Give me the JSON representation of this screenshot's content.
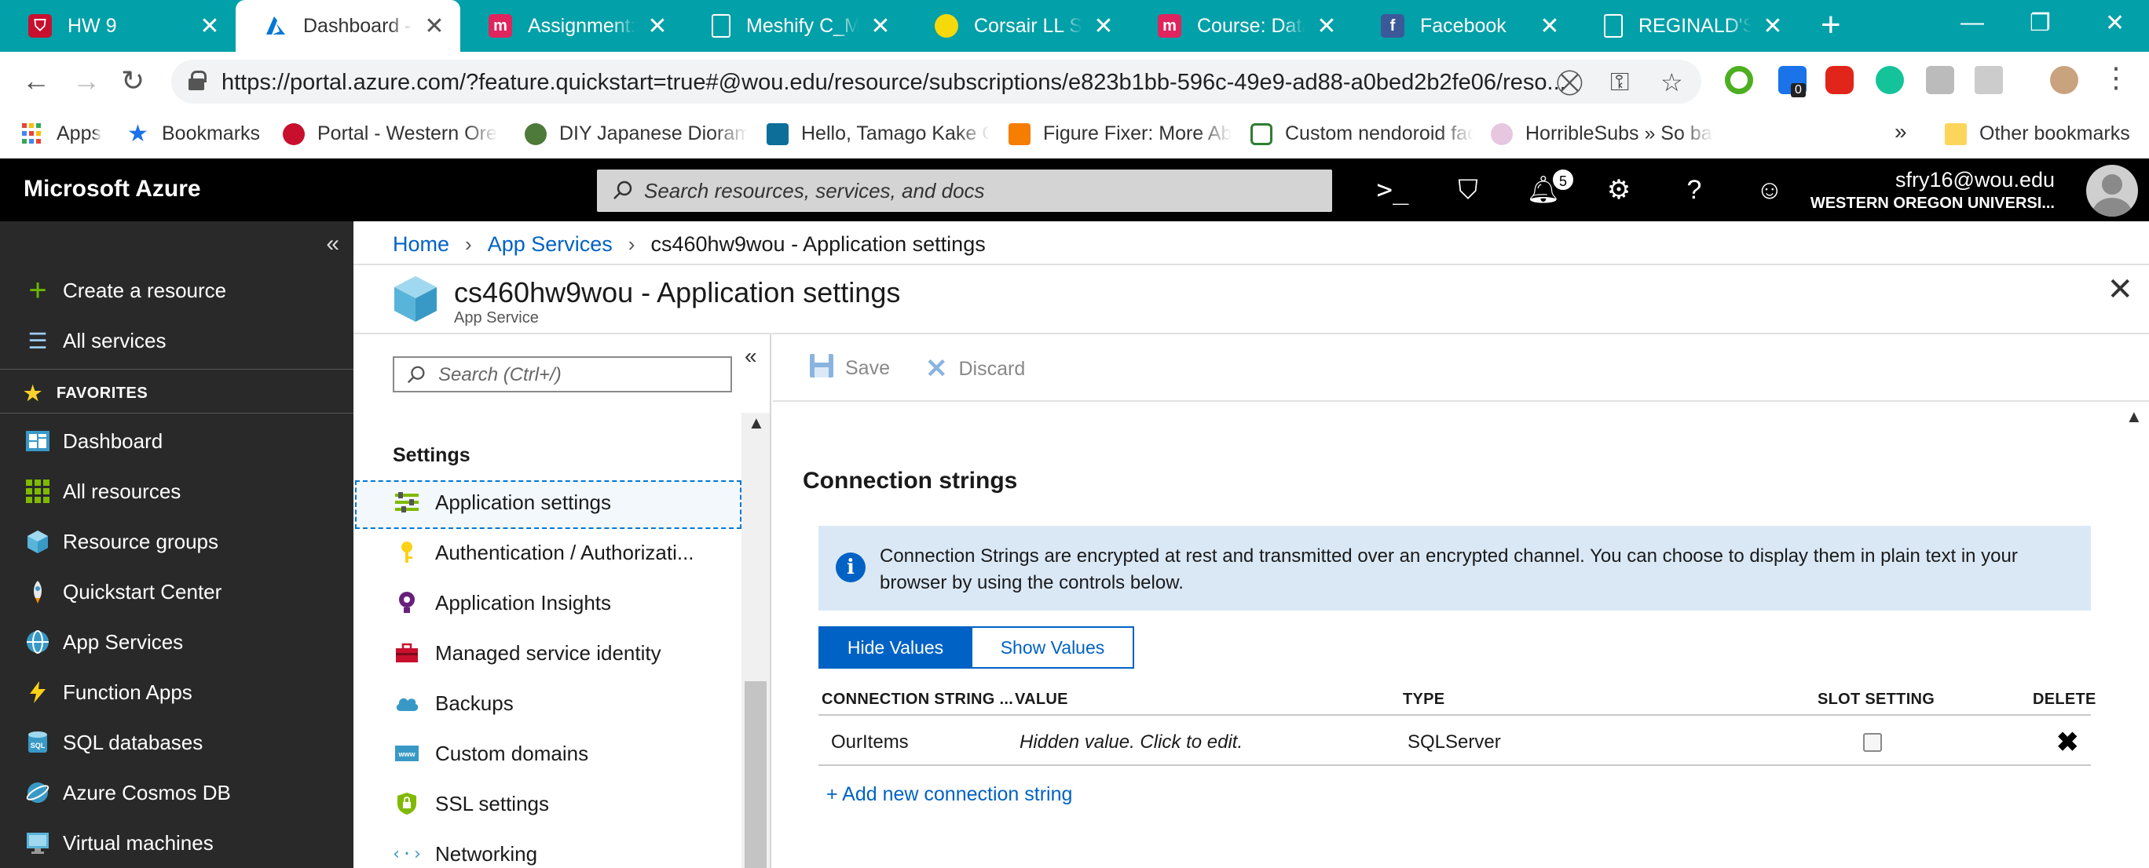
{
  "browser": {
    "tabs": [
      {
        "title": "HW 9",
        "favicon_color": "#c8102e",
        "active": false
      },
      {
        "title": "Dashboard - Microsoft Azure",
        "favicon_color": "#0078d4",
        "active": true
      },
      {
        "title": "Assignment: Portfolio",
        "favicon_color": "#e0245e",
        "active": false
      },
      {
        "title": "Meshify C_Manual",
        "favicon_color": "#ffffff",
        "active": false
      },
      {
        "title": "Corsair LL Series",
        "favicon_color": "#f5d90a",
        "active": false
      },
      {
        "title": "Course: Data Structures",
        "favicon_color": "#e0245e",
        "active": false
      },
      {
        "title": "Facebook",
        "favicon_color": "#3b5998",
        "active": false
      },
      {
        "title": "REGINALD'S Arcade",
        "favicon_color": "#ffffff",
        "active": false
      }
    ],
    "new_tab": "+",
    "url": "https://portal.azure.com/?feature.quickstart=true#@wou.edu/resource/subscriptions/e823b1bb-596c-49e9-ad88-a0bed2b2fe06/reso...",
    "bookmarks": [
      {
        "label": "Apps"
      },
      {
        "label": "Bookmarks"
      },
      {
        "label": "Portal - Western Oregon"
      },
      {
        "label": "DIY Japanese Diorama"
      },
      {
        "label": "Hello, Tamago Kake Gohan"
      },
      {
        "label": "Figure Fixer: More Abs"
      },
      {
        "label": "Custom nendoroid face"
      },
      {
        "label": "HorribleSubs » So bad"
      }
    ],
    "more_bookmarks": "»",
    "other_bookmarks": "Other bookmarks",
    "extension_badge": "0"
  },
  "azure": {
    "brand": "Microsoft Azure",
    "search_placeholder": "Search resources, services, and docs",
    "notification_count": "5",
    "user_email": "sfry16@wou.edu",
    "user_tenant": "WESTERN OREGON UNIVERSI...",
    "sidebar": {
      "create": "Create a resource",
      "all_services": "All services",
      "favorites_header": "FAVORITES",
      "favorites": [
        "Dashboard",
        "All resources",
        "Resource groups",
        "Quickstart Center",
        "App Services",
        "Function Apps",
        "SQL databases",
        "Azure Cosmos DB",
        "Virtual machines"
      ]
    },
    "breadcrumb": {
      "home": "Home",
      "app_services": "App Services",
      "current": "cs460hw9wou - Application settings"
    },
    "blade": {
      "title": "cs460hw9wou - Application settings",
      "subtitle": "App Service"
    },
    "resource_menu": {
      "search_placeholder": "Search (Ctrl+/)",
      "section": "Settings",
      "items": [
        "Application settings",
        "Authentication / Authorizati...",
        "Application Insights",
        "Managed service identity",
        "Backups",
        "Custom domains",
        "SSL settings",
        "Networking"
      ]
    },
    "commands": {
      "save": "Save",
      "discard": "Discard"
    },
    "connection_strings": {
      "title": "Connection strings",
      "info": "Connection Strings are encrypted at rest and transmitted over an encrypted channel. You can choose to display them in plain text in your browser by using the controls below.",
      "hide_values": "Hide Values",
      "show_values": "Show Values",
      "columns": [
        "CONNECTION STRING ...",
        "VALUE",
        "TYPE",
        "SLOT SETTING",
        "DELETE"
      ],
      "rows": [
        {
          "name": "OurItems",
          "value": "Hidden value. Click to edit.",
          "type": "SQLServer",
          "slot_setting": false
        }
      ],
      "add_link": "+ Add new connection string"
    }
  }
}
